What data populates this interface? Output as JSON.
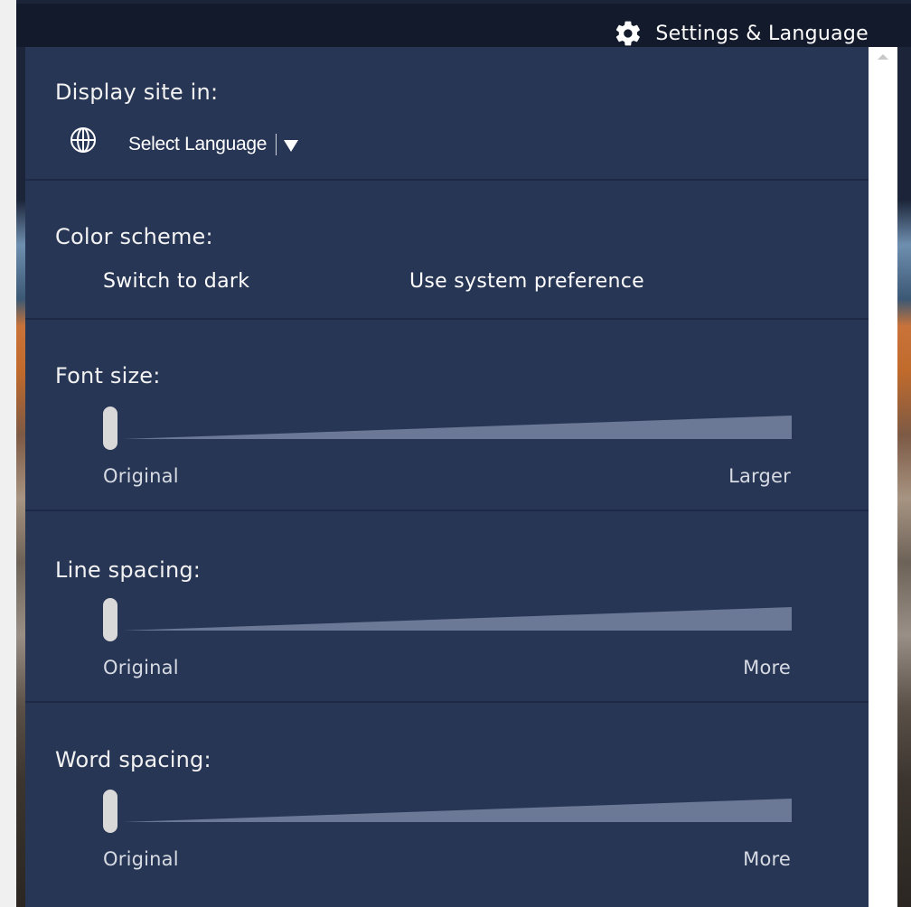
{
  "topbar": {
    "title": "Settings & Language"
  },
  "display": {
    "label": "Display site in:",
    "select_label": "Select Language"
  },
  "color_scheme": {
    "label": "Color scheme:",
    "dark_label": "Switch to dark",
    "system_label": "Use system preference"
  },
  "font_size": {
    "label": "Font size:",
    "min_label": "Original",
    "max_label": "Larger",
    "value": 0
  },
  "line_spacing": {
    "label": "Line spacing:",
    "min_label": "Original",
    "max_label": "More",
    "value": 0
  },
  "word_spacing": {
    "label": "Word spacing:",
    "min_label": "Original",
    "max_label": "More",
    "value": 0
  },
  "colors": {
    "panel_bg": "#283655",
    "topbar_bg": "#131a2b",
    "ramp": "#6b7896",
    "thumb": "#d9d9d9"
  },
  "icons": {
    "settings": "gear-icon",
    "language": "globe-icon",
    "dropdown": "triangle-down-icon",
    "scroll": "scroll-up-arrow-icon"
  }
}
